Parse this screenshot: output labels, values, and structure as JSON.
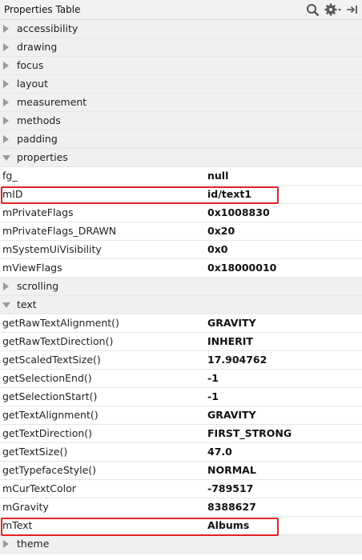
{
  "panel": {
    "title": "Properties Table"
  },
  "toolbar": {
    "search_icon": "search-icon",
    "settings_icon": "gear-icon",
    "collapse_icon": "pin-right-icon"
  },
  "groups_before": [
    {
      "label": "accessibility",
      "expanded": false
    },
    {
      "label": "drawing",
      "expanded": false
    },
    {
      "label": "focus",
      "expanded": false
    },
    {
      "label": "layout",
      "expanded": false
    },
    {
      "label": "measurement",
      "expanded": false
    },
    {
      "label": "methods",
      "expanded": false
    },
    {
      "label": "padding",
      "expanded": false
    }
  ],
  "properties_group": {
    "label": "properties",
    "expanded": true,
    "rows": [
      {
        "name": "fg_",
        "value": "null"
      },
      {
        "name": "mID",
        "value": "id/text1",
        "highlighted": true
      },
      {
        "name": "mPrivateFlags",
        "value": "0x1008830"
      },
      {
        "name": "mPrivateFlags_DRAWN",
        "value": "0x20"
      },
      {
        "name": "mSystemUiVisibility",
        "value": "0x0"
      },
      {
        "name": "mViewFlags",
        "value": "0x18000010"
      }
    ]
  },
  "scrolling_group": {
    "label": "scrolling",
    "expanded": false
  },
  "text_group": {
    "label": "text",
    "expanded": true,
    "rows": [
      {
        "name": "getRawTextAlignment()",
        "value": "GRAVITY"
      },
      {
        "name": "getRawTextDirection()",
        "value": "INHERIT"
      },
      {
        "name": "getScaledTextSize()",
        "value": "17.904762"
      },
      {
        "name": "getSelectionEnd()",
        "value": "-1"
      },
      {
        "name": "getSelectionStart()",
        "value": "-1"
      },
      {
        "name": "getTextAlignment()",
        "value": "GRAVITY"
      },
      {
        "name": "getTextDirection()",
        "value": "FIRST_STRONG"
      },
      {
        "name": "getTextSize()",
        "value": "47.0"
      },
      {
        "name": "getTypefaceStyle()",
        "value": "NORMAL"
      },
      {
        "name": "mCurTextColor",
        "value": "-789517"
      },
      {
        "name": "mGravity",
        "value": "8388627"
      },
      {
        "name": "mText",
        "value": "Albums",
        "highlighted": true
      }
    ]
  },
  "theme_group": {
    "label": "theme",
    "expanded": false
  },
  "colors": {
    "highlight": "#e52020",
    "group_bg": "#f0f0f0"
  }
}
